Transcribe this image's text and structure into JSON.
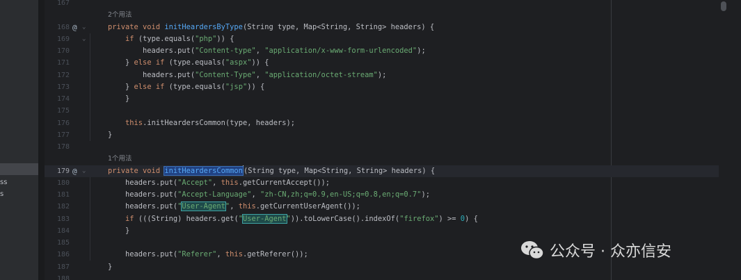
{
  "project_fragments": [
    "ss",
    "s"
  ],
  "editor": {
    "lines": [
      {
        "n": "167",
        "tokens": []
      },
      {
        "hint": "2个用法"
      },
      {
        "n": "168",
        "marker": "@",
        "fold": "⌄",
        "tokens": [
          {
            "t": "private void ",
            "c": "kw"
          },
          {
            "t": "initHeardersByType",
            "c": "fn"
          },
          {
            "t": "(String type, Map<String, String> headers) {"
          }
        ]
      },
      {
        "n": "169",
        "fold": "⌄",
        "tokens": [
          {
            "t": "    "
          },
          {
            "t": "if ",
            "c": "kw"
          },
          {
            "t": "(type.equals("
          },
          {
            "t": "\"php\"",
            "c": "str"
          },
          {
            "t": ")) {"
          }
        ]
      },
      {
        "n": "170",
        "tokens": [
          {
            "t": "        headers.put("
          },
          {
            "t": "\"Content-type\"",
            "c": "str"
          },
          {
            "t": ", "
          },
          {
            "t": "\"application/x-www-form-urlencoded\"",
            "c": "str"
          },
          {
            "t": ");"
          }
        ]
      },
      {
        "n": "171",
        "tokens": [
          {
            "t": "    } "
          },
          {
            "t": "else if ",
            "c": "kw"
          },
          {
            "t": "(type.equals("
          },
          {
            "t": "\"aspx\"",
            "c": "str"
          },
          {
            "t": ")) {"
          }
        ]
      },
      {
        "n": "172",
        "tokens": [
          {
            "t": "        headers.put("
          },
          {
            "t": "\"Content-Type\"",
            "c": "str"
          },
          {
            "t": ", "
          },
          {
            "t": "\"application/octet-stream\"",
            "c": "str"
          },
          {
            "t": ");"
          }
        ]
      },
      {
        "n": "173",
        "tokens": [
          {
            "t": "    } "
          },
          {
            "t": "else if ",
            "c": "kw"
          },
          {
            "t": "(type.equals("
          },
          {
            "t": "\"jsp\"",
            "c": "str"
          },
          {
            "t": ")) {"
          }
        ]
      },
      {
        "n": "174",
        "tokens": [
          {
            "t": "    }"
          }
        ]
      },
      {
        "n": "175",
        "tokens": []
      },
      {
        "n": "176",
        "tokens": [
          {
            "t": "    "
          },
          {
            "t": "this",
            "c": "kw"
          },
          {
            "t": "."
          },
          {
            "t": "initHeardersCommon",
            "c": "hl"
          },
          {
            "t": "(type, headers);"
          }
        ]
      },
      {
        "n": "177",
        "tokens": [
          {
            "t": "}"
          }
        ]
      },
      {
        "n": "178",
        "tokens": []
      },
      {
        "hint": "1个用法"
      },
      {
        "n": "179",
        "marker": "@",
        "fold": "⌄",
        "current": true,
        "tokens": [
          {
            "t": "private void ",
            "c": "kw"
          },
          {
            "t": "initHeardersCommon",
            "c": "selword"
          },
          {
            "t": "",
            "c": "caret"
          },
          {
            "t": "(String type, Map<String, String> headers) {"
          }
        ]
      },
      {
        "n": "180",
        "tokens": [
          {
            "t": "    headers.put("
          },
          {
            "t": "\"Accept\"",
            "c": "str"
          },
          {
            "t": ", "
          },
          {
            "t": "this",
            "c": "kw"
          },
          {
            "t": ".getCurrentAccept());"
          }
        ]
      },
      {
        "n": "181",
        "tokens": [
          {
            "t": "    headers.put("
          },
          {
            "t": "\"Accept-Language\"",
            "c": "str"
          },
          {
            "t": ", "
          },
          {
            "t": "\"zh-CN,zh;q=0.9,en-US;q=0.8,en;q=0.7\"",
            "c": "str"
          },
          {
            "t": ");"
          }
        ]
      },
      {
        "n": "182",
        "tokens": [
          {
            "t": "    headers.put("
          },
          {
            "t": "\"",
            "c": "str"
          },
          {
            "t": "User-Agent",
            "c": "box"
          },
          {
            "t": "\"",
            "c": "str"
          },
          {
            "t": ", "
          },
          {
            "t": "this",
            "c": "kw"
          },
          {
            "t": ".getCurrentUserAgent());"
          }
        ]
      },
      {
        "n": "183",
        "tokens": [
          {
            "t": "    "
          },
          {
            "t": "if ",
            "c": "kw"
          },
          {
            "t": "(((String) headers.get("
          },
          {
            "t": "\"",
            "c": "str"
          },
          {
            "t": "User-Agent",
            "c": "box"
          },
          {
            "t": "\"",
            "c": "str"
          },
          {
            "t": ")).toLowerCase().indexOf("
          },
          {
            "t": "\"firefox\"",
            "c": "str"
          },
          {
            "t": ") >= "
          },
          {
            "t": "0",
            "c": "num"
          },
          {
            "t": ") {"
          }
        ]
      },
      {
        "n": "184",
        "tokens": [
          {
            "t": "    }"
          }
        ]
      },
      {
        "n": "185",
        "tokens": []
      },
      {
        "n": "186",
        "tokens": [
          {
            "t": "    headers.put("
          },
          {
            "t": "\"Referer\"",
            "c": "str"
          },
          {
            "t": ", "
          },
          {
            "t": "this",
            "c": "kw"
          },
          {
            "t": ".getReferer());"
          }
        ]
      },
      {
        "n": "187",
        "tokens": [
          {
            "t": "}"
          }
        ]
      },
      {
        "n": "188",
        "tokens": []
      }
    ]
  },
  "watermark": {
    "text": "公众号 · 众亦信安",
    "icon": "wechat-icon"
  },
  "colors": {
    "background": "#1e1f22",
    "keyword": "#cf8e6d",
    "function": "#56a8f5",
    "string": "#6aab73",
    "number": "#2aacb8"
  }
}
